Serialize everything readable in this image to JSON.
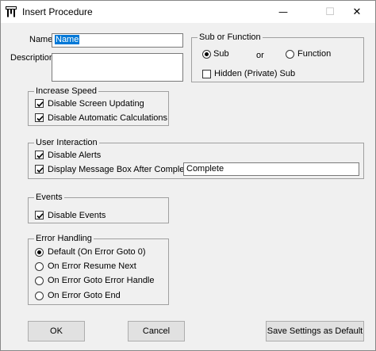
{
  "window": {
    "title": "Insert Procedure"
  },
  "fields": {
    "name_label": "Name",
    "name_value": "Name",
    "description_label": "Description",
    "description_value": ""
  },
  "sub_or_function": {
    "legend": "Sub or Function",
    "sub_label": "Sub",
    "or_label": "or",
    "function_label": "Function",
    "hidden_label": "Hidden (Private) Sub",
    "selected": "Sub",
    "hidden_checked": false
  },
  "increase_speed": {
    "legend": "Increase Speed",
    "items": [
      {
        "label": "Disable Screen Updating",
        "checked": true
      },
      {
        "label": "Disable Automatic Calculations",
        "checked": true
      }
    ]
  },
  "user_interaction": {
    "legend": "User Interaction",
    "items": [
      {
        "label": "Disable Alerts",
        "checked": true
      },
      {
        "label": "Display Message Box After Complete",
        "checked": true
      }
    ],
    "message_value": "Complete"
  },
  "events": {
    "legend": "Events",
    "items": [
      {
        "label": "Disable Events",
        "checked": true
      }
    ]
  },
  "error_handling": {
    "legend": "Error Handling",
    "options": [
      {
        "label": "Default (On Error Goto 0)",
        "selected": true
      },
      {
        "label": "On Error Resume Next",
        "selected": false
      },
      {
        "label": "On Error Goto Error Handle",
        "selected": false
      },
      {
        "label": "On Error Goto End",
        "selected": false
      }
    ]
  },
  "buttons": {
    "ok": "OK",
    "cancel": "Cancel",
    "save_default": "Save Settings as Default"
  }
}
